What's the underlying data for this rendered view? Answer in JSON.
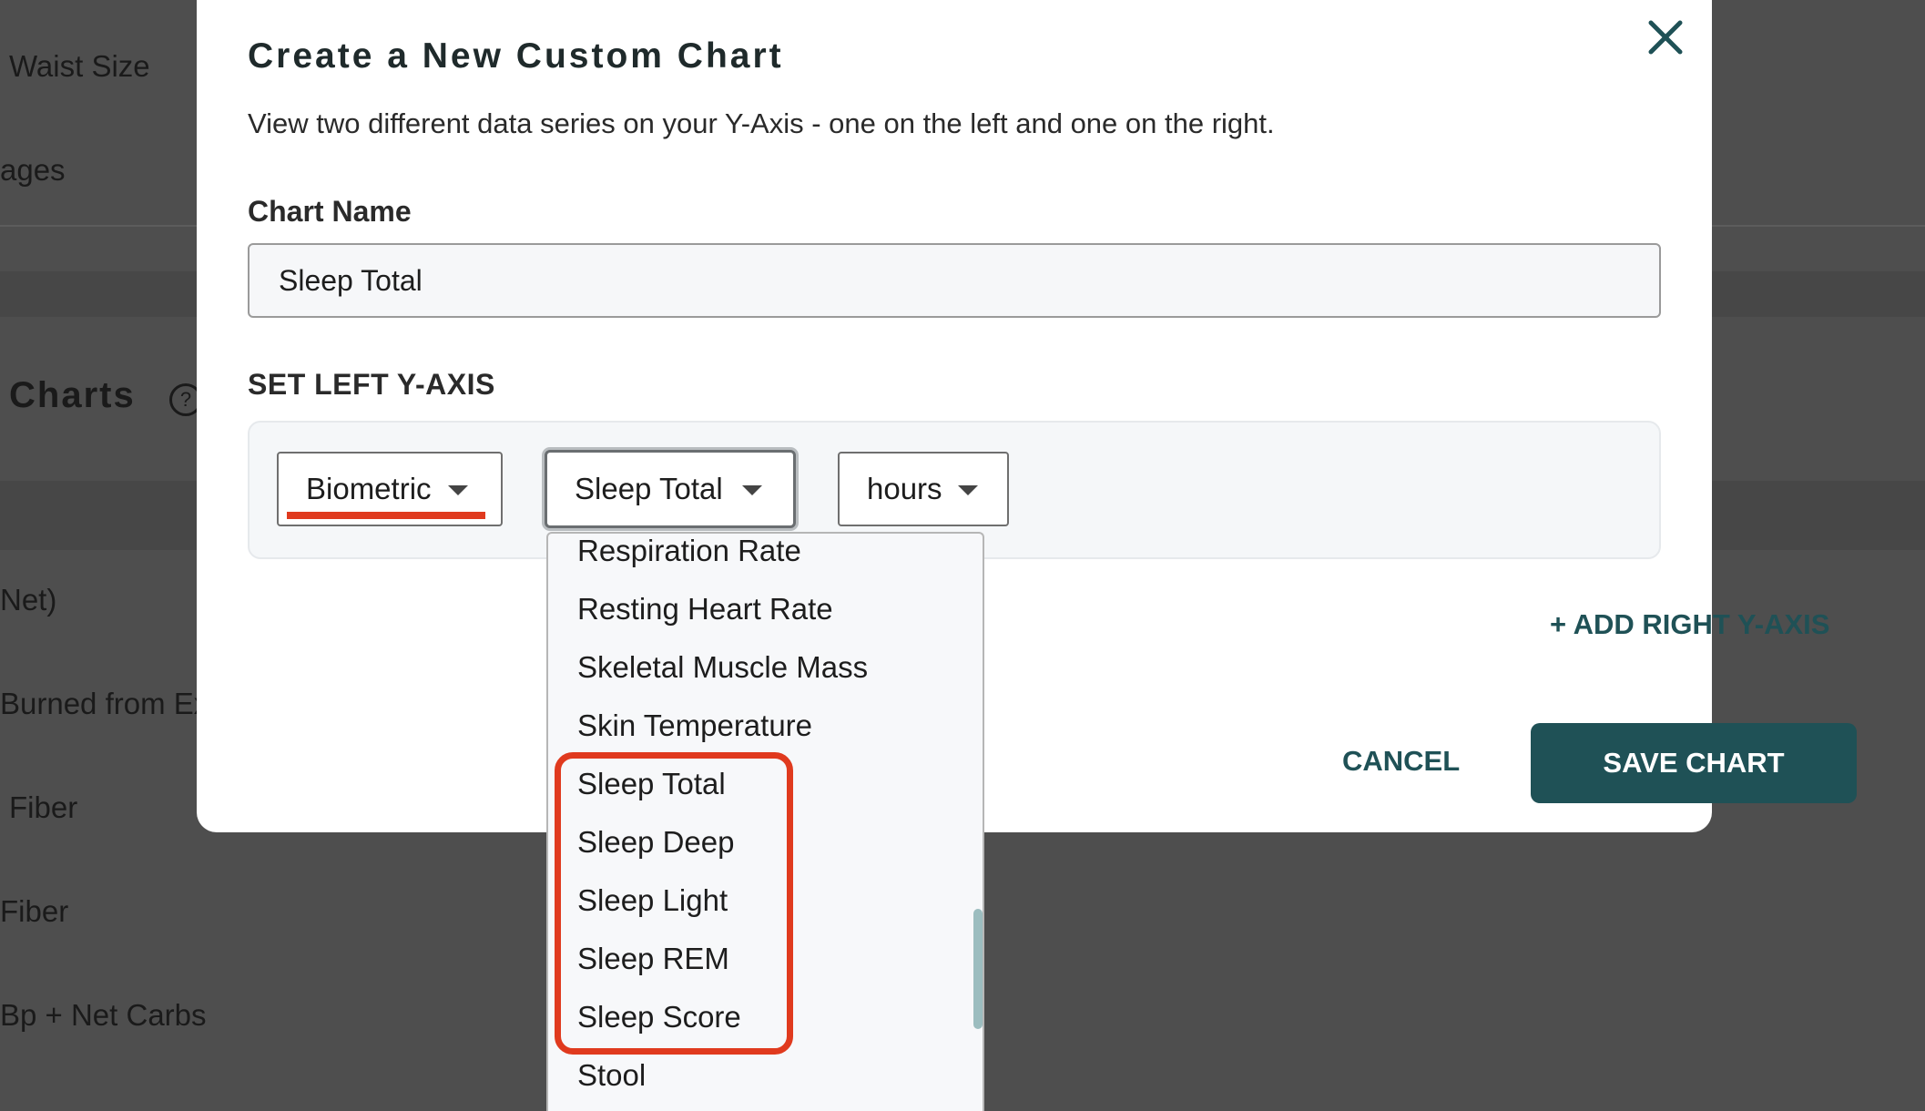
{
  "background": {
    "items": [
      "Waist Size",
      "ages",
      "Net)",
      "Burned from Ex",
      "Fiber",
      "Fiber",
      "Bp + Net Carbs"
    ],
    "charts_heading": "Charts",
    "help_glyph": "?"
  },
  "modal": {
    "title": "Create a New Custom Chart",
    "description": "View two different data series on your Y-Axis - one on the left and one on the right.",
    "chart_name_label": "Chart Name",
    "chart_name_value": "Sleep Total",
    "left_axis_label": "SET LEFT Y-AXIS",
    "selects": {
      "category": "Biometric",
      "metric": "Sleep Total",
      "unit": "hours"
    },
    "add_right_axis": "+ ADD RIGHT Y-AXIS",
    "cancel_label": "CANCEL",
    "save_label": "SAVE CHART"
  },
  "dropdown": {
    "options": [
      "Respiration Rate",
      "Resting Heart Rate",
      "Skeletal Muscle Mass",
      "Skin Temperature",
      "Sleep Total",
      "Sleep Deep",
      "Sleep Light",
      "Sleep REM",
      "Sleep Score",
      "Stool"
    ]
  },
  "colors": {
    "accent": "#1f5156",
    "annotation_red": "#e03a1e",
    "overlay": "#4e4e4e"
  },
  "icons": {
    "close": "close-icon",
    "caret": "caret-down-icon",
    "help": "help-circle-icon"
  }
}
